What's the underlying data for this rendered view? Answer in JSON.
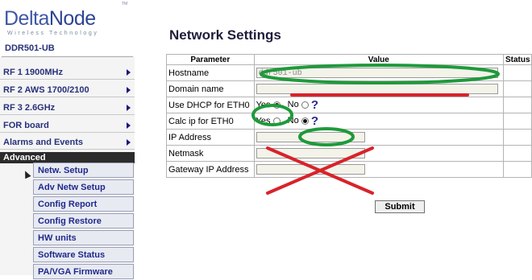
{
  "logo": {
    "brand_a": "Delta",
    "brand_b": "Node",
    "tagline": "Wireless Technology",
    "tm": "TM"
  },
  "device": "DDR501-UB",
  "menu": [
    {
      "label": "RF 1 1900MHz"
    },
    {
      "label": "RF 2 AWS 1700/2100"
    },
    {
      "label": "RF 3 2.6GHz"
    },
    {
      "label": "FOR board"
    },
    {
      "label": "Alarms and Events"
    }
  ],
  "advanced": {
    "label": "Advanced"
  },
  "submenu": [
    {
      "label": "Netw. Setup"
    },
    {
      "label": "Adv Netw Setup"
    },
    {
      "label": "Config Report"
    },
    {
      "label": "Config Restore"
    },
    {
      "label": "HW units"
    },
    {
      "label": "Software Status"
    },
    {
      "label": "PA/VGA Firmware"
    }
  ],
  "page": {
    "title": "Network Settings"
  },
  "table": {
    "headers": [
      "Parameter",
      "Value",
      "Status"
    ],
    "rows": {
      "hostname": {
        "label": "Hostname",
        "value": "ddr501-ub"
      },
      "domain": {
        "label": "Domain name",
        "value": ""
      },
      "dhcp": {
        "label": "Use DHCP for ETH0",
        "yes": "Yes",
        "no": "No",
        "help": "?"
      },
      "calc": {
        "label": "Calc ip for ETH0",
        "yes": "Yes",
        "no": "No",
        "help": "?"
      },
      "ip": {
        "label": "IP Address",
        "value": ""
      },
      "netmask": {
        "label": "Netmask",
        "value": ""
      },
      "gateway": {
        "label": "Gateway IP Address",
        "value": ""
      }
    },
    "dhcp_selected": "Yes",
    "calc_selected": "No"
  },
  "submit_label": "Submit",
  "colors": {
    "annotation_green": "#1e9a3a",
    "annotation_red": "#d8232a",
    "menu_text": "#28317a"
  }
}
